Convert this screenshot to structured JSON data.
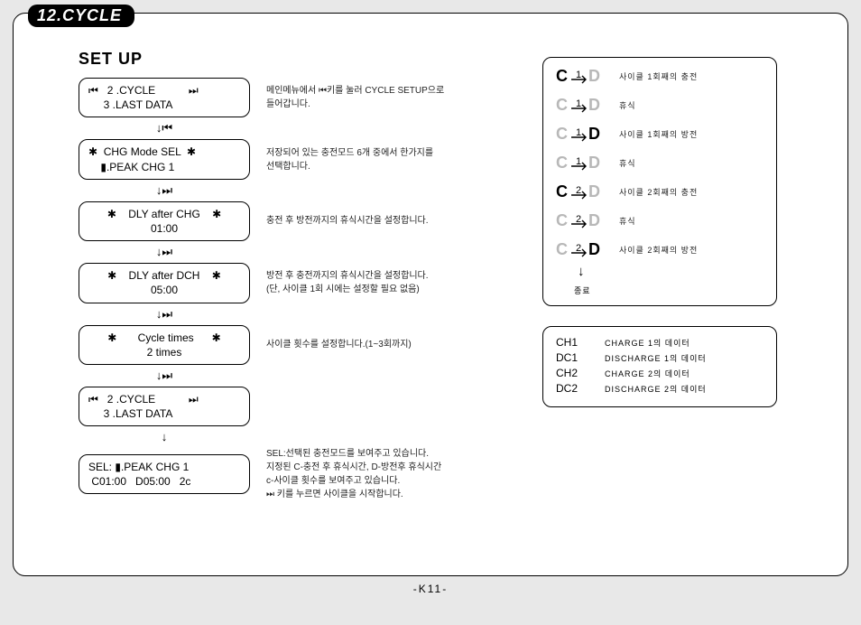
{
  "header": {
    "tab": "12.CYCLE"
  },
  "setup": {
    "title": "SET UP",
    "steps": [
      {
        "lines": [
          "⏮   2 .CYCLE           ⏭",
          "     3 .LAST DATA"
        ],
        "desc": "메인메뉴에서 ⏮키를 눌러 CYCLE SETUP으로\n들어갑니다.",
        "arrow": "↓⏮"
      },
      {
        "lines": [
          "✱  CHG Mode SEL  ✱",
          "    ▮.PEAK CHG 1"
        ],
        "desc": "저장되어 있는 충전모드 6개 중에서 한가지를\n선택합니다.",
        "arrow": "↓⏭"
      },
      {
        "center": true,
        "lines": [
          "✱    DLY after CHG    ✱",
          "01:00"
        ],
        "desc": "충전 후 방전까지의 휴식시간을 설정합니다.",
        "arrow": "↓⏭"
      },
      {
        "center": true,
        "lines": [
          "✱    DLY after DCH    ✱",
          "05:00"
        ],
        "desc": "방전 후 충전까지의 휴식시간을 설정합니다.\n(단, 사이클 1회 시에는 설정할 필요 없음)",
        "arrow": "↓⏭"
      },
      {
        "center": true,
        "lines": [
          "✱       Cycle times      ✱",
          "2 times"
        ],
        "desc": "사이클 횟수를 설정합니다.(1~3회까지)",
        "arrow": "↓⏭"
      },
      {
        "lines": [
          "⏮   2 .CYCLE           ⏭",
          "     3 .LAST DATA"
        ],
        "desc": "",
        "arrow": "↓"
      },
      {
        "lines": [
          "SEL: ▮.PEAK CHG 1",
          " C01:00   D05:00   2c"
        ],
        "desc": "SEL:선택된 충전모드를 보여주고 있습니다.\n지정된 C-충전 후 휴식시간, D-방전후 휴식시간\nc-사이클 횟수를 보여주고 있습니다.\n⏭ 키를 누르면 사이클을 시작합니다.",
        "arrow": ""
      }
    ]
  },
  "sequence": {
    "items": [
      {
        "n": "1",
        "active": "C",
        "desc": "사이클 1회째의 충전"
      },
      {
        "n": "1",
        "active": "",
        "desc": "휴식"
      },
      {
        "n": "1",
        "active": "D",
        "desc": "사이클 1회째의 방전"
      },
      {
        "n": "1",
        "active": "",
        "desc": "휴식"
      },
      {
        "n": "2",
        "active": "C",
        "desc": "사이클 2회째의 충전"
      },
      {
        "n": "2",
        "active": "",
        "desc": "휴식"
      },
      {
        "n": "2",
        "active": "D",
        "desc": "사이클 2회째의 방전"
      }
    ],
    "end": "종료"
  },
  "data_legend": {
    "rows": [
      {
        "k": "CH1",
        "v": "CHARGE 1의 데이터"
      },
      {
        "k": "DC1",
        "v": "DISCHARGE 1의 데이터"
      },
      {
        "k": "CH2",
        "v": "CHARGE 2의 데이터"
      },
      {
        "k": "DC2",
        "v": "DISCHARGE 2의 데이터"
      }
    ]
  },
  "page_number": "-K11-"
}
